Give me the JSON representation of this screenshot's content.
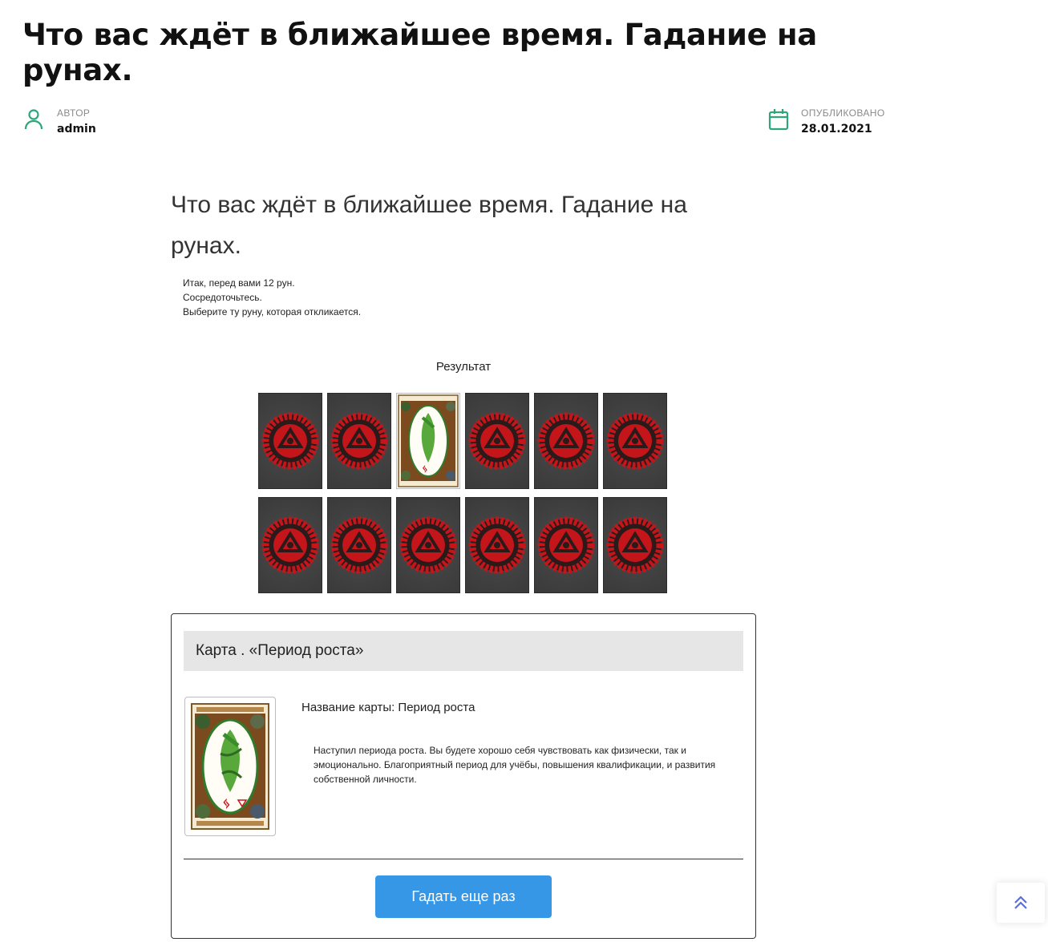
{
  "post": {
    "title": "Что вас ждёт в ближайшее время. Гадание на рунах.",
    "author_label": "АВТОР",
    "author": "admin",
    "published_label": "ОПУБЛИКОВАНО",
    "published_date": "28.01.2021"
  },
  "article": {
    "title": "Что вас ждёт в ближайшее время. Гадание на рунах.",
    "intro": [
      "Итак, перед вами 12 рун.",
      "Сосредоточьтесь.",
      "Выберите ту руну, которая откликается."
    ],
    "result_label": "Результат"
  },
  "cards": [
    {
      "state": "back"
    },
    {
      "state": "back"
    },
    {
      "state": "face"
    },
    {
      "state": "back"
    },
    {
      "state": "back"
    },
    {
      "state": "back"
    },
    {
      "state": "back"
    },
    {
      "state": "back"
    },
    {
      "state": "back"
    },
    {
      "state": "back"
    },
    {
      "state": "back"
    },
    {
      "state": "back"
    }
  ],
  "result": {
    "header": "Карта . «Период роста»",
    "card_name": "Название карты: Период роста",
    "description": "Наступил периода роста. Вы будете хорошо себя чувствовать как физически, так и эмоционально. Благоприятный период для учёбы, повышения квалификации, и развития собственной личности.",
    "again_button": "Гадать еще раз"
  },
  "colors": {
    "accent_green": "#2ea67a",
    "button_blue": "#3797e7",
    "rune_red": "#c4151b"
  },
  "icons": {
    "author": "user-icon",
    "date": "calendar-icon",
    "scroll_top": "double-chevron-up-icon"
  }
}
